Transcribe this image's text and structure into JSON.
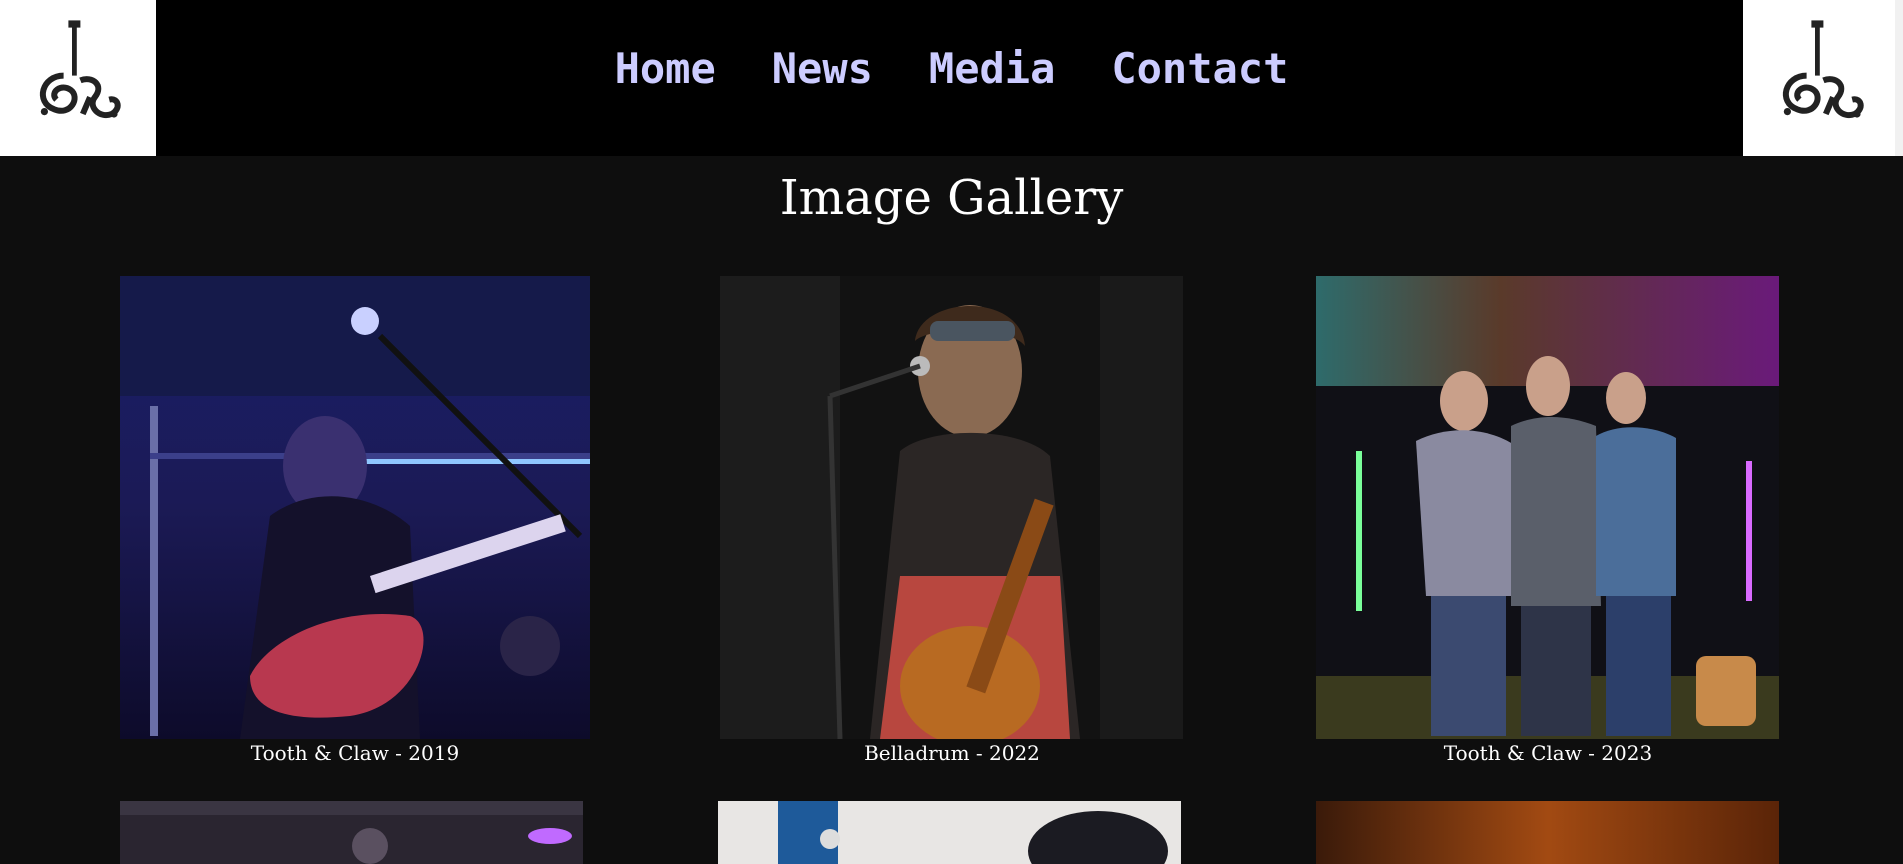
{
  "header": {
    "logo_alt": "SR logo",
    "nav": [
      {
        "label": "Home"
      },
      {
        "label": "News"
      },
      {
        "label": "Media"
      },
      {
        "label": "Contact"
      }
    ]
  },
  "main": {
    "title": "Image Gallery",
    "gallery": [
      {
        "caption": "Tooth & Claw - 2019"
      },
      {
        "caption": "Belladrum - 2022"
      },
      {
        "caption": "Tooth & Claw - 2023"
      }
    ]
  },
  "colors": {
    "page_bg": "#0e0e0e",
    "header_bg": "#000000",
    "nav_text": "#ccccff",
    "title_text": "#ffffff"
  }
}
